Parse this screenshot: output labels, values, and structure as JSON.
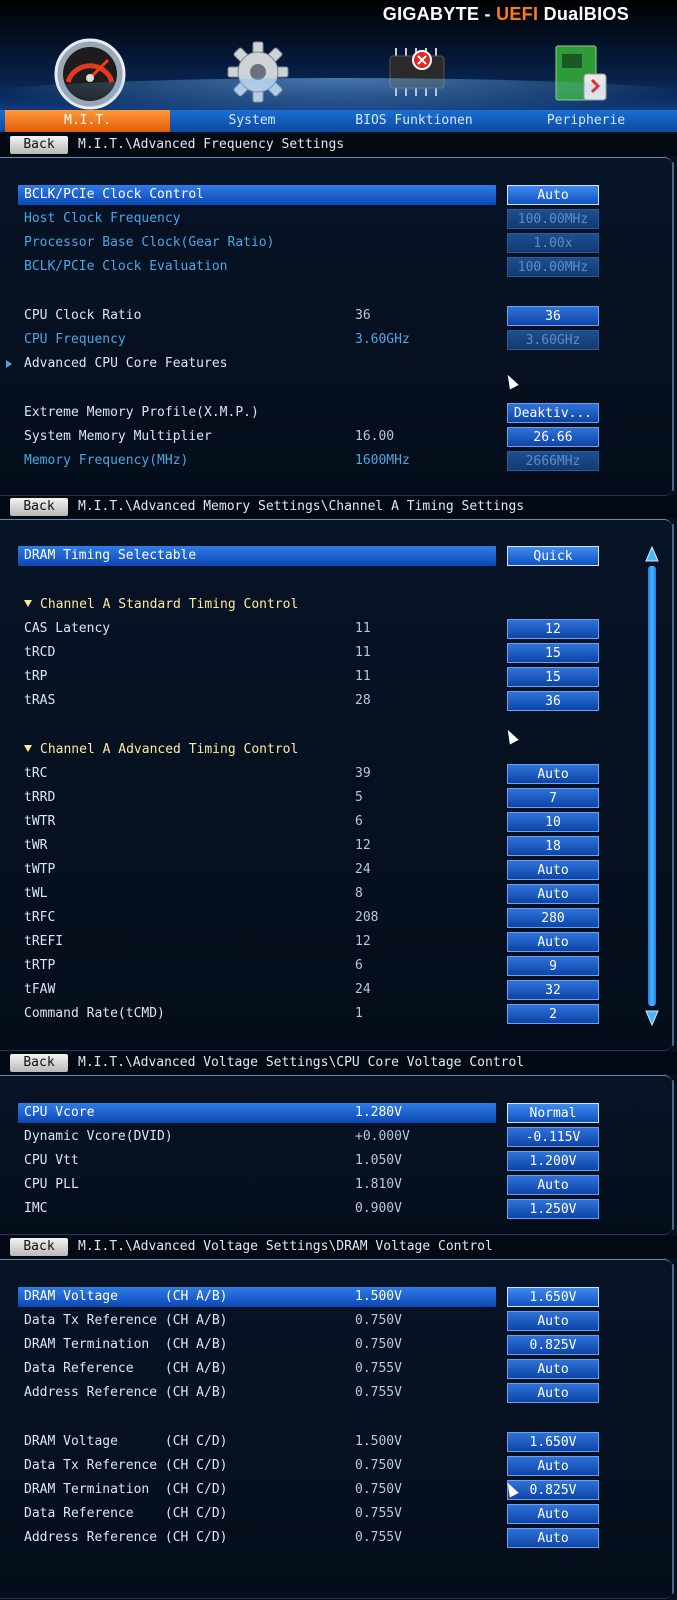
{
  "brand": {
    "prefix": "GIGABYTE - ",
    "accent": "UEFI",
    "suffix": " DualBIOS"
  },
  "tabs": [
    {
      "label": "M.I.T.",
      "active": true
    },
    {
      "label": "System",
      "active": false
    },
    {
      "label": "BIOS Funktionen",
      "active": false
    },
    {
      "label": "Peripherie",
      "active": false
    }
  ],
  "back_label": "Back",
  "sections": [
    {
      "path": "M.I.T.\\Advanced Frequency Settings",
      "rows": [
        {
          "label": "BCLK/PCIe Clock Control",
          "current": "",
          "value": "Auto",
          "selected": true
        },
        {
          "label": "Host Clock Frequency",
          "current": "",
          "value": "100.00MHz",
          "disabled": true
        },
        {
          "label": "Processor Base Clock(Gear Ratio)",
          "current": "",
          "value": "1.00x",
          "disabled": true
        },
        {
          "label": "BCLK/PCIe Clock Evaluation",
          "current": "",
          "value": "100.00MHz",
          "disabled": true
        },
        {
          "label": "CPU Clock Ratio",
          "current": "36",
          "value": "36"
        },
        {
          "label": "CPU Frequency",
          "current": "3.60GHz",
          "value": "3.60GHz",
          "disabled": true
        },
        {
          "label": "Advanced CPU Core Features",
          "current": "",
          "value": "",
          "submenu": true
        },
        {
          "label": "Extreme Memory Profile(X.M.P.)",
          "current": "",
          "value": "Deaktiv..."
        },
        {
          "label": "System Memory Multiplier",
          "current": "16.00",
          "value": "26.66"
        },
        {
          "label": "Memory Frequency(MHz)",
          "current": "1600MHz",
          "value": "2666MHz",
          "disabled": true
        }
      ]
    },
    {
      "path": "M.I.T.\\Advanced Memory Settings\\Channel A Timing Settings",
      "rows": [
        {
          "label": "DRAM Timing Selectable",
          "current": "",
          "value": "Quick",
          "selected": true
        },
        {
          "label": "Channel A Standard Timing Control",
          "current": "",
          "value": "",
          "section": true
        },
        {
          "label": "CAS Latency",
          "current": "11",
          "value": "12"
        },
        {
          "label": "tRCD",
          "current": "11",
          "value": "15"
        },
        {
          "label": "tRP",
          "current": "11",
          "value": "15"
        },
        {
          "label": "tRAS",
          "current": "28",
          "value": "36"
        },
        {
          "label": "Channel A Advanced Timing Control",
          "current": "",
          "value": "",
          "section": true
        },
        {
          "label": "tRC",
          "current": "39",
          "value": "Auto"
        },
        {
          "label": "tRRD",
          "current": "5",
          "value": "7"
        },
        {
          "label": "tWTR",
          "current": "6",
          "value": "10"
        },
        {
          "label": "tWR",
          "current": "12",
          "value": "18"
        },
        {
          "label": "tWTP",
          "current": "24",
          "value": "Auto"
        },
        {
          "label": "tWL",
          "current": "8",
          "value": "Auto"
        },
        {
          "label": "tRFC",
          "current": "208",
          "value": "280"
        },
        {
          "label": "tREFI",
          "current": "12",
          "value": "Auto"
        },
        {
          "label": "tRTP",
          "current": "6",
          "value": "9"
        },
        {
          "label": "tFAW",
          "current": "24",
          "value": "32"
        },
        {
          "label": "Command Rate(tCMD)",
          "current": "1",
          "value": "2"
        }
      ]
    },
    {
      "path": "M.I.T.\\Advanced Voltage Settings\\CPU Core Voltage Control",
      "rows": [
        {
          "label": "CPU Vcore",
          "current": "1.280V",
          "value": "Normal",
          "selected": true
        },
        {
          "label": "Dynamic Vcore(DVID)",
          "current": "+0.000V",
          "value": "-0.115V"
        },
        {
          "label": "CPU Vtt",
          "current": "1.050V",
          "value": "1.200V"
        },
        {
          "label": "CPU PLL",
          "current": "1.810V",
          "value": "Auto"
        },
        {
          "label": "IMC",
          "current": "0.900V",
          "value": "1.250V"
        }
      ]
    },
    {
      "path": "M.I.T.\\Advanced Voltage Settings\\DRAM Voltage Control",
      "rows": [
        {
          "label": "DRAM Voltage      (CH A/B)",
          "current": "1.500V",
          "value": "1.650V",
          "selected": true
        },
        {
          "label": "Data Tx Reference (CH A/B)",
          "current": "0.750V",
          "value": "Auto"
        },
        {
          "label": "DRAM Termination  (CH A/B)",
          "current": "0.750V",
          "value": "0.825V"
        },
        {
          "label": "Data Reference    (CH A/B)",
          "current": "0.755V",
          "value": "Auto"
        },
        {
          "label": "Address Reference (CH A/B)",
          "current": "0.755V",
          "value": "Auto"
        },
        {
          "label": "DRAM Voltage      (CH C/D)",
          "current": "1.500V",
          "value": "1.650V"
        },
        {
          "label": "Data Tx Reference (CH C/D)",
          "current": "0.750V",
          "value": "Auto"
        },
        {
          "label": "DRAM Termination  (CH C/D)",
          "current": "0.750V",
          "value": "0.825V"
        },
        {
          "label": "Data Reference    (CH C/D)",
          "current": "0.755V",
          "value": "Auto"
        },
        {
          "label": "Address Reference (CH C/D)",
          "current": "0.755V",
          "value": "Auto"
        }
      ]
    }
  ],
  "colors": {
    "accent": "#ff7a1a",
    "tab_bar": "#1a6fd0",
    "selected_row": "#2f7de6",
    "dim_text": "#4aa6e6",
    "section_text": "#ffe9a0"
  },
  "icons": [
    "speedometer-icon",
    "gear-icon",
    "chip-icon",
    "peripheral-card-icon",
    "scroll-up-icon",
    "scroll-down-icon",
    "submenu-arrow-icon",
    "section-triangle-icon",
    "mouse-cursor-icon"
  ]
}
